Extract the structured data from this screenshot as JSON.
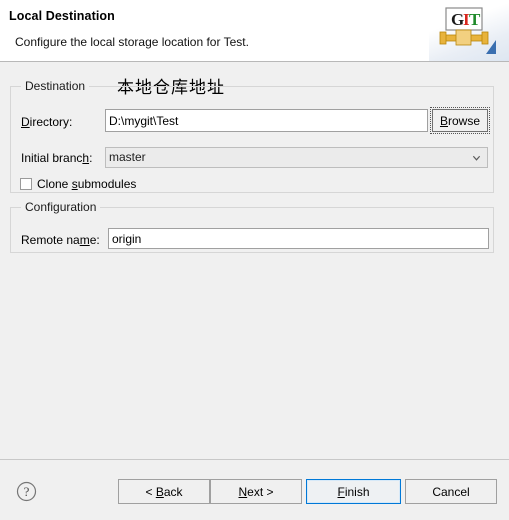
{
  "header": {
    "title": "Local Destination",
    "subtitle": "Configure the local storage location for Test.",
    "logo_letters": [
      "G",
      "I",
      "T"
    ],
    "logo_colors": {
      "g": "#1a1a1a",
      "i": "#d8261d",
      "t": "#1f8a2a",
      "pipe": "#e8b33c",
      "arrow": "#3a6fb0"
    }
  },
  "annotation": {
    "text": "本地仓库地址"
  },
  "destination_group": {
    "label": "Destination",
    "directory": {
      "label_pre": "D",
      "label_post": "irectory:",
      "value": "D:\\mygit\\Test",
      "placeholder": ""
    },
    "browse_button": {
      "label_pre": "B",
      "label_mn": "r",
      "label_post": "owse"
    },
    "initial_branch": {
      "label_pre": "Initial branc",
      "label_mn": "h",
      "label_post": ":",
      "value": "master",
      "options": [
        "master"
      ],
      "chevron": "chevron-down-icon"
    },
    "clone_submodules": {
      "label_pre": "Clone ",
      "label_mn": "s",
      "label_post": "ubmodules",
      "checked": false
    }
  },
  "configuration_group": {
    "label": "Configuration",
    "remote_name": {
      "label_pre": "Remote na",
      "label_mn": "m",
      "label_post": "e:",
      "value": "origin",
      "placeholder": ""
    }
  },
  "footer": {
    "help_icon": "question-mark-icon",
    "buttons": [
      {
        "id": "back",
        "pre": "< ",
        "mn": "B",
        "post": "ack"
      },
      {
        "id": "next",
        "pre": "",
        "mn": "N",
        "post": "ext >"
      },
      {
        "id": "finish",
        "pre": "",
        "mn": "F",
        "post": "inish"
      },
      {
        "id": "cancel",
        "pre": "Cancel",
        "mn": "",
        "post": ""
      }
    ],
    "default_button": "finish",
    "accent_color": "#0078d7"
  }
}
